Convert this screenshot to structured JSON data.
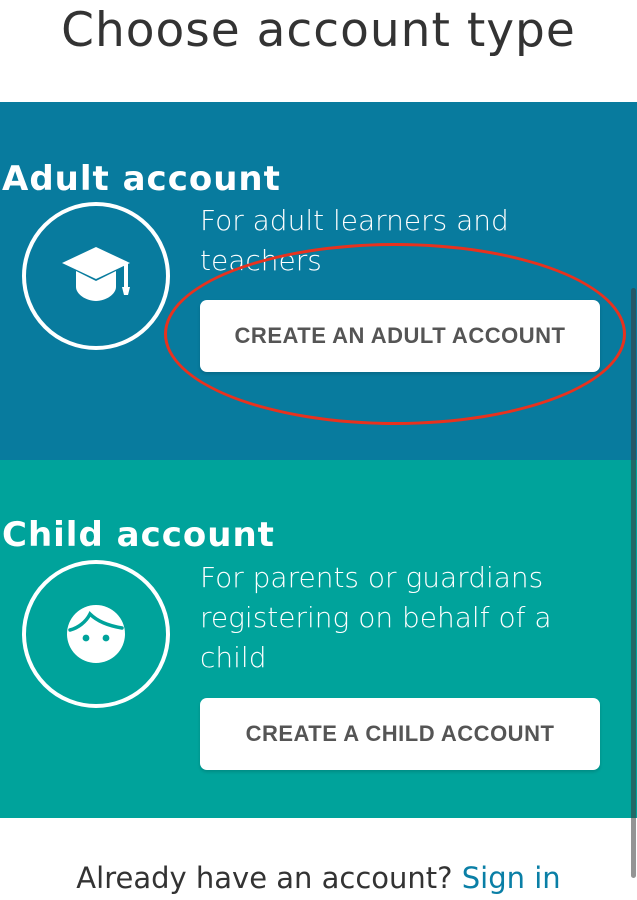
{
  "page": {
    "title": "Choose account type"
  },
  "colors": {
    "adult_bg": "#087b9e",
    "child_bg": "#00a39b",
    "text_dark": "#333333",
    "button_text": "#555555",
    "link": "#0a7fa6",
    "highlight": "#e8321e"
  },
  "adult": {
    "heading": "Adult account",
    "icon": "graduation-cap-icon",
    "description": "For adult learners and teachers",
    "button_label": "CREATE AN ADULT ACCOUNT"
  },
  "child": {
    "heading": "Child account",
    "icon": "child-face-icon",
    "description": "For parents or guardians registering on behalf of a child",
    "button_label": "CREATE A CHILD ACCOUNT"
  },
  "footer": {
    "prompt": "Already have an account?",
    "sign_in_label": "Sign in"
  }
}
